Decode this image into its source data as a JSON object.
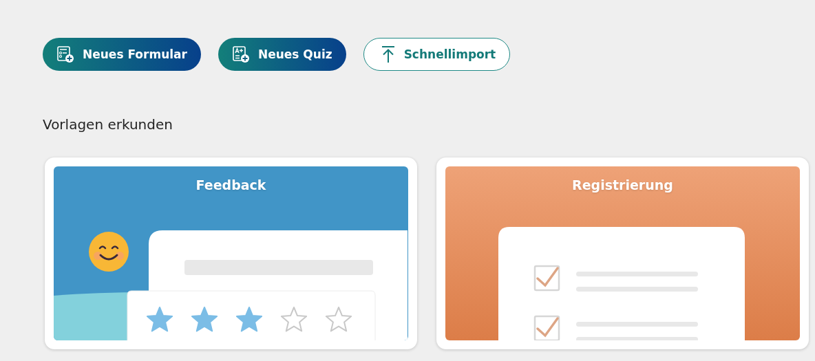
{
  "actions": [
    {
      "kind": "form",
      "label": "Neues Formular"
    },
    {
      "kind": "quiz",
      "label": "Neues Quiz"
    },
    {
      "kind": "import",
      "label": "Schnellimport"
    }
  ],
  "section_title": "Vorlagen erkunden",
  "templates": [
    {
      "kind": "feedback",
      "title": "Feedback",
      "stars": 3
    },
    {
      "kind": "registration",
      "title": "Registrierung"
    }
  ]
}
